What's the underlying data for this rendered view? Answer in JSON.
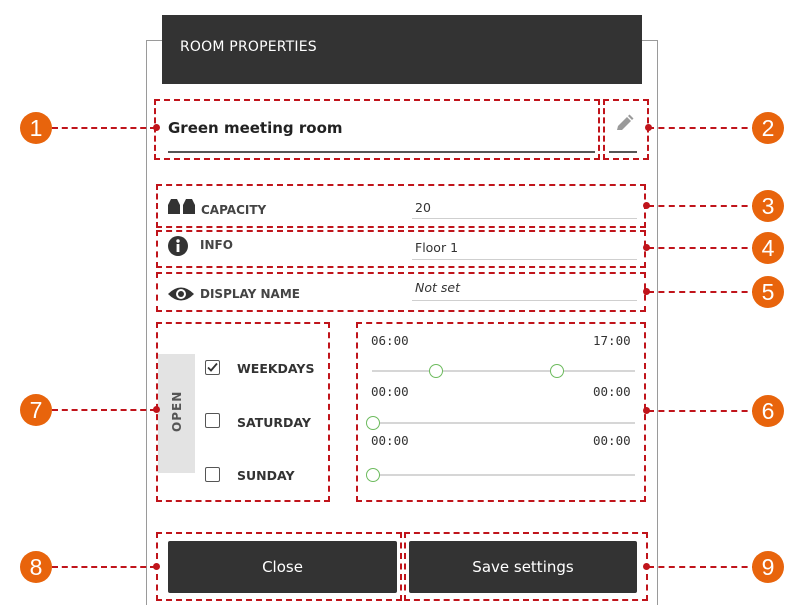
{
  "dialog": {
    "title": "ROOM PROPERTIES",
    "room_name": "Green meeting room"
  },
  "fields": {
    "capacity": {
      "label": "CAPACITY",
      "value": "20",
      "icon": "capacity-icon"
    },
    "info": {
      "label": "INFO",
      "value": "Floor 1",
      "icon": "info-icon"
    },
    "display_name": {
      "label": "DISPLAY NAME",
      "value": "Not set",
      "icon": "eye-icon"
    }
  },
  "open": {
    "tab_label": "OPEN",
    "days": [
      {
        "label": "WEEKDAYS",
        "checked": true
      },
      {
        "label": "SATURDAY",
        "checked": false
      },
      {
        "label": "SUNDAY",
        "checked": false
      }
    ]
  },
  "schedule": [
    {
      "start": "06:00",
      "end": "17:00"
    },
    {
      "start": "00:00",
      "end": "00:00"
    },
    {
      "start": "00:00",
      "end": "00:00"
    }
  ],
  "buttons": {
    "close": "Close",
    "save": "Save settings"
  },
  "callouts": [
    "1",
    "2",
    "3",
    "4",
    "5",
    "6",
    "7",
    "8",
    "9"
  ],
  "colors": {
    "callout_badge": "#e8640c",
    "callout_line": "#c0141b",
    "header_bg": "#333333",
    "slider_knob": "#6dbb5e"
  }
}
